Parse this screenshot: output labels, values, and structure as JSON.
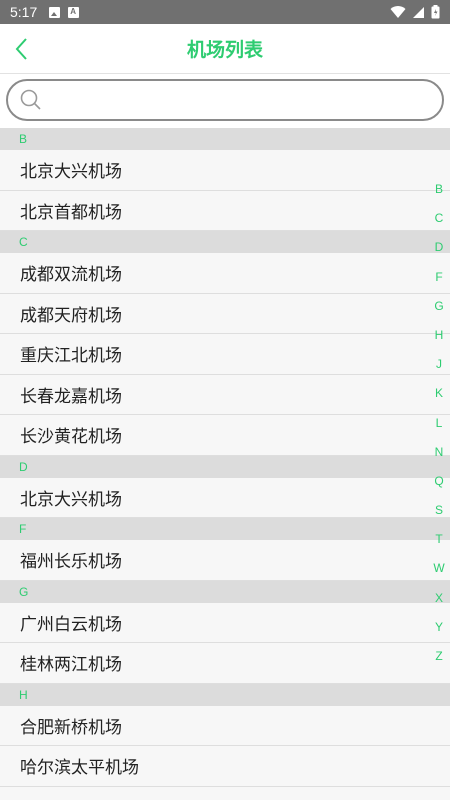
{
  "status_bar": {
    "time": "5:17"
  },
  "nav": {
    "title": "机场列表",
    "back_icon": "chevron-left-icon",
    "accent": "#2ecc71"
  },
  "search": {
    "placeholder": "",
    "value": ""
  },
  "sections": [
    {
      "letter": "B",
      "items": [
        "北京大兴机场",
        "北京首都机场"
      ]
    },
    {
      "letter": "C",
      "items": [
        "成都双流机场",
        "成都天府机场",
        "重庆江北机场",
        "长春龙嘉机场",
        "长沙黄花机场"
      ]
    },
    {
      "letter": "D",
      "items": [
        "北京大兴机场"
      ]
    },
    {
      "letter": "F",
      "items": [
        "福州长乐机场"
      ]
    },
    {
      "letter": "G",
      "items": [
        "广州白云机场",
        "桂林两江机场"
      ]
    },
    {
      "letter": "H",
      "items": [
        "合肥新桥机场",
        "哈尔滨太平机场"
      ]
    }
  ],
  "index_letters": [
    "B",
    "C",
    "D",
    "F",
    "G",
    "H",
    "J",
    "K",
    "L",
    "N",
    "Q",
    "S",
    "T",
    "W",
    "X",
    "Y",
    "Z"
  ]
}
